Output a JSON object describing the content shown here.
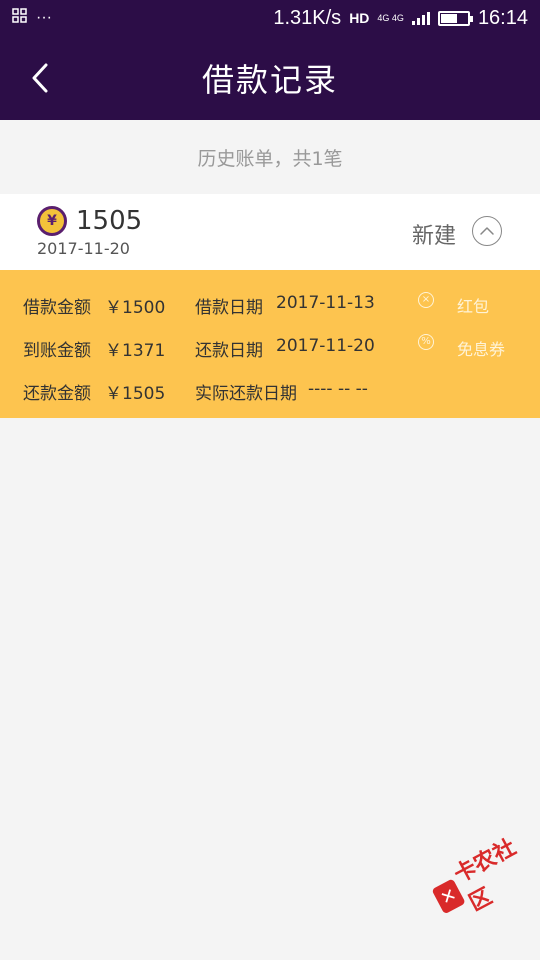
{
  "status_bar": {
    "icons": [
      "grid-icon",
      "more-dots-icon"
    ],
    "network_speed": "1.31K/s",
    "hd_label": "HD",
    "network_type": "4G 4G",
    "time": "16:14",
    "battery_level_percent": 65
  },
  "nav": {
    "back_icon": "chevron-left-icon",
    "title": "借款记录"
  },
  "history": {
    "caption": "历史账单，共1笔"
  },
  "record": {
    "coin_symbol": "¥",
    "amount": "1505",
    "date": "2017-11-20",
    "status": "新建",
    "toggle_icon": "chevron-up-icon"
  },
  "details": {
    "loan_amount_label": "借款金额",
    "loan_amount_value": "￥1500",
    "loan_date_label": "借款日期",
    "loan_date_value": "2017-11-13",
    "received_amount_label": "到账金额",
    "received_amount_value": "￥1371",
    "repay_date_label": "还款日期",
    "repay_date_value": "2017-11-20",
    "repay_amount_label": "还款金额",
    "repay_amount_value": "￥1505",
    "actual_repay_date_label": "实际还款日期",
    "actual_repay_date_value": "---- -- --",
    "coupon_red_packet": "红包",
    "coupon_interest_free": "免息券"
  },
  "watermark": {
    "text": "卡农社区"
  },
  "colors": {
    "header_bg": "#2c0d47",
    "details_bg": "#fdc44f",
    "page_bg": "#f4f4f4"
  }
}
